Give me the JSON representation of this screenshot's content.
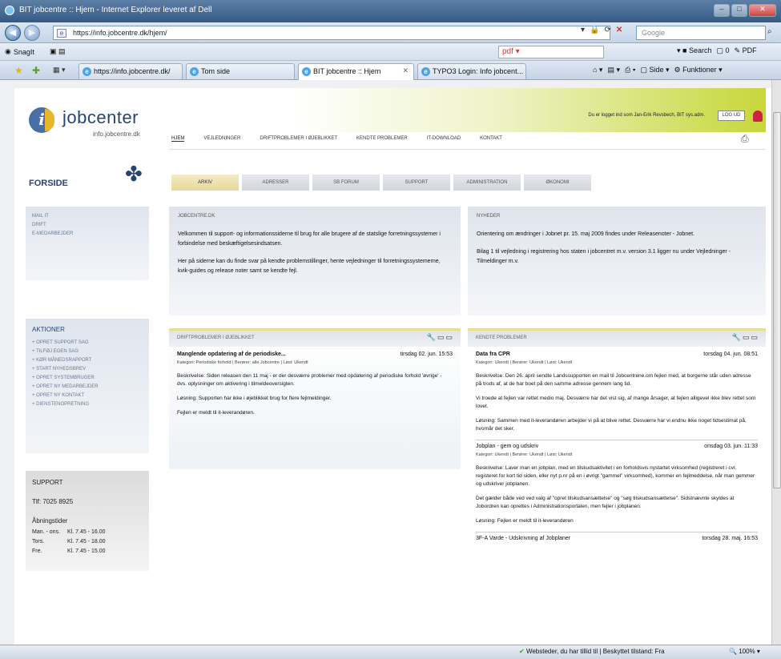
{
  "browser": {
    "title": "BIT jobcentre :: Hjem - Internet Explorer leveret af Dell",
    "address": "https://info.jobcentre.dk/hjem/",
    "search_placeholder": "Google",
    "toolbar_snagit": "SnagIt",
    "pdf_label": "pdf",
    "search_label": "Search",
    "pdf_count": "0",
    "pdf_text": "PDF",
    "tabs": [
      {
        "label": "https://info.jobcentre.dk/"
      },
      {
        "label": "Tom side"
      },
      {
        "label": "BIT jobcentre :: Hjem",
        "active": true
      },
      {
        "label": "TYPO3 Login: Info jobcent..."
      }
    ],
    "cmd_side": "Side",
    "cmd_funktioner": "Funktioner",
    "status_zone": "Websteder, du har tillid til | Beskyttet tilstand: Fra",
    "zoom": "100%"
  },
  "site": {
    "logo_name": "jobcenter",
    "logo_sub": "info.jobcentre.dk",
    "forside": "FORSIDE",
    "logged_in_text": "Du er logget ind som Jan-Erik Revsbech, BIT sys.adm.",
    "logout": "LOG UD",
    "nav": [
      "HJEM",
      "VEJLEDNINGER",
      "DRIFTPROBLEMER I ØJEBLIKKET",
      "KENDTE PROBLEMER",
      "IT-DOWNLOAD",
      "KONTAKT"
    ],
    "subtabs": [
      "ARKIV",
      "ADRESSER",
      "SB FORUM",
      "SUPPORT",
      "ADMINISTRATION",
      "ØKONOMI"
    ],
    "side_links": [
      "MAIL IT",
      "DRIFT",
      "E-MEDARBEJDER"
    ],
    "actions_title": "AKTIONER",
    "actions": [
      "+ OPRET SUPPORT SAG",
      "+ TILFØJ EGEN SAG",
      "+ KØR MÅNEDSRAPPORT",
      "+ START NYHEDSBREV",
      "+ OPRET SYSTEMBRUGER",
      "+ OPRET NY MEDARBEJDER",
      "+ OPRET NY KONTAKT",
      "+ DIENSTENOPRETNING"
    ],
    "support": {
      "title": "SUPPORT",
      "phone": "Tlf: 7025 8925",
      "hours_title": "Åbningstider",
      "hours": [
        {
          "day": "Man. - ons.",
          "time": "Kl. 7.45 - 16.00"
        },
        {
          "day": "Tors.",
          "time": "Kl. 7.45 - 18.00"
        },
        {
          "day": "Fre.",
          "time": "Kl. 7.45 - 15.00"
        }
      ]
    },
    "intro": {
      "title": "JOBCENTRE.DK",
      "p1": "Velkommen til support- og informationssiderne til brug for alle brugere af de statslige forretningssystemer i forbindelse med beskæftigelsesindsatsen.",
      "p2": "Her på siderne kan du finde svar på kendte problemstillinger, hente vejledninger til forretningssystemerne, kvik-guides og release noter samt se kendte fejl."
    },
    "news": {
      "title": "NYHEDER",
      "p1": "Orientering om ændringer i Jobnet pr. 15. maj 2009 findes under Releasenoter - Jobnet.",
      "p2": "Bilag 1 til vejledning i registrering hos staten i jobcentret m.v. version 3.1 ligger nu under Vejledninger - Tilmeldinger m.v."
    },
    "drift": {
      "title": "DRIFTPROBLEMER I ØJEBLIKKET",
      "entry_title": "Manglende opdatering af de periodiske...",
      "entry_date": "tirsdag 02. jun. 15:53",
      "meta": "Kategori: Periodiske forhold | Berører: alle Jobcentre | Løst: Ukendt",
      "p1": "Beskrivelse: Siden releasen den 11 maj - er der desværre problemer med opdatering af periodiske forhold 'øvrige' - dvs. oplysninger om aktivering i tilmeldeoversigten.",
      "p2": "Løsning: Supporten har ikke i øjeblikket brug for flere fejlmeldinger.",
      "p3": "Fejlen er meldt til it-leverandøren."
    },
    "known": {
      "title": "KENDTE PROBLEMER",
      "entries": [
        {
          "title": "Data fra CPR",
          "date": "torsdag 04. jun. 08:51",
          "meta": "Kategori: Ukendt | Berører: Ukendt | Løst: Ukendt",
          "paras": [
            "Beskrivelse: Den 26. april sendte Landssupporten en mail til Jobcentrene.om fejlen med, at borgerne står uden adresse på trods af, at de har boet på den samme adresse gennem lang tid.",
            "Vi troede at fejlen var rettet medio maj. Desværre har det vist sig, af mange årsager, at fejlen alligevel ikke blev rettet som lovet.",
            "Løsning: Sammen med it-leverandøren arbejder vi på at blive rettet. Desværre har vi endnu ikke noget tidsestimat på, hvornår det sker."
          ]
        },
        {
          "title": "Jobplan - gem og udskriv",
          "date": "onsdag 03. jun. 11:33",
          "meta": "Kategori: Ukendt | Berører: Ukendt | Løst: Ukendt",
          "paras": [
            "Beskrivelse: Laver man en jobplan, med en tilskudsaktivitet i en forholdsvis nystartet virksomhed (registreret i cvr. registeret for kort tid siden, eller nyt p.nr på en i øvrigt \"gammel\" virksomhed), kommer en fejlmeddelse, når man gemmer og udskriver jobplanen.",
            "Det gælder både ved ved valg af \"opret tilskudsansættelse\" og \"søg tilskudsansættelse\". Sidstnævnte skyldes at Jobordren kan oprettes i Administrationsportalen, men fejler i jobplanen.",
            "Løsning: Fejlen er meldt til it-leverandøren"
          ]
        },
        {
          "title": "3F-A Varde - Udskrivning af Jobplaner",
          "date": "torsdag 28. maj. 16:53",
          "meta": "",
          "paras": []
        }
      ]
    }
  }
}
